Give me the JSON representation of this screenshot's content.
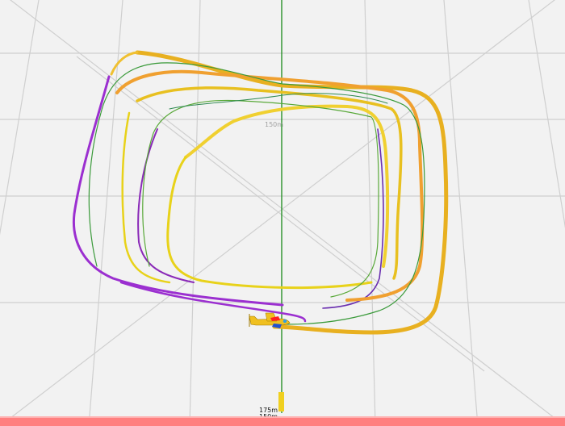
{
  "viewer": {
    "background": "#f2f2f2",
    "grid_color": "#c8c8c8",
    "axis_color": "#1a8a1a",
    "bottom_bar_color": "#ff7f7f"
  },
  "labels": {
    "ring_label": "150m",
    "altitude_top": "175m",
    "altitude_bottom": "150m"
  },
  "track": {
    "colors": {
      "high": "#e8d21a",
      "mid": "#f0a030",
      "low": "#9b2fd0",
      "thin": "#3a9a3a"
    }
  },
  "aircraft": {
    "icon": "airplane-icon",
    "body_color": "#f0c020",
    "accent_color": "#ff2020"
  }
}
